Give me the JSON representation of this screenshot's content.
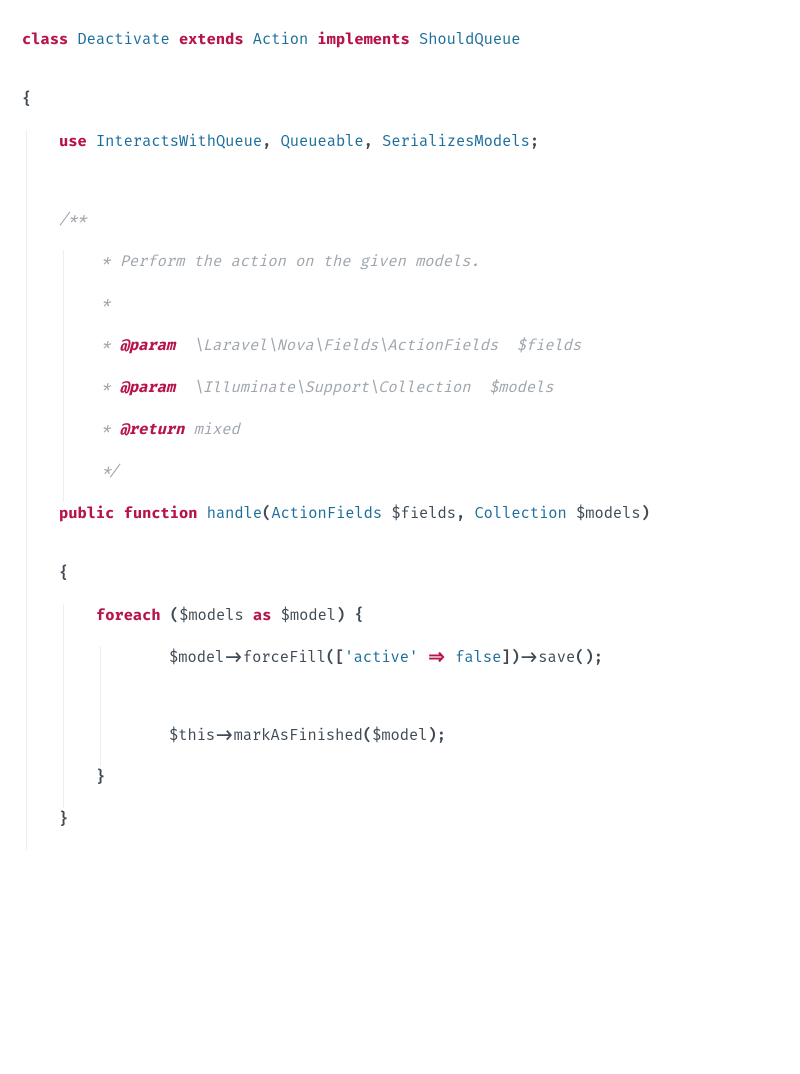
{
  "lang": "php",
  "tokens": {
    "kw_class": "class",
    "cls_name": "Deactivate",
    "kw_extends": "extends",
    "base_cls": "Action",
    "kw_implements": "implements",
    "iface": "ShouldQueue",
    "brace_open": "{",
    "brace_close": "}",
    "kw_use": "use",
    "trait1": "InteractsWithQueue",
    "comma_sp": ", ",
    "trait2": "Queueable",
    "trait3": "SerializesModels",
    "semi": ";",
    "doc_open": "/**",
    "doc_l1": " * Perform the action on the given models.",
    "doc_blank": " *",
    "doc_tag_param": "@param",
    "doc_param1_type": "\\Laravel\\Nova\\Fields\\ActionFields  $fields",
    "doc_param2_type": "\\Illuminate\\Support\\Collection  $models",
    "doc_tag_return": "@return",
    "doc_return_type": "mixed",
    "doc_close": " */",
    "kw_public": "public",
    "kw_function": "function",
    "fn_name": "handle",
    "paren_open": "(",
    "paren_close": ")",
    "param1_type": "ActionFields",
    "param1_var": "$fields",
    "param2_type": "Collection",
    "param2_var": "$models",
    "kw_foreach": "foreach",
    "foreach_var": "$models",
    "kw_as": "as",
    "foreach_item": "$model",
    "stmt1_obj": "$model",
    "arrow": "->",
    "m_forceFill": "forceFill",
    "arr_open": "([",
    "key_active": "'active'",
    "fat_arrow": "=>",
    "val_false": "false",
    "arr_close": "])",
    "m_save": "save",
    "call_close": "()",
    "stmt2_obj": "$this",
    "m_mark": "markAsFinished",
    "stmt2_arg": "$model",
    "doc_star_sp": " * ",
    "doc_sp2": "  "
  }
}
